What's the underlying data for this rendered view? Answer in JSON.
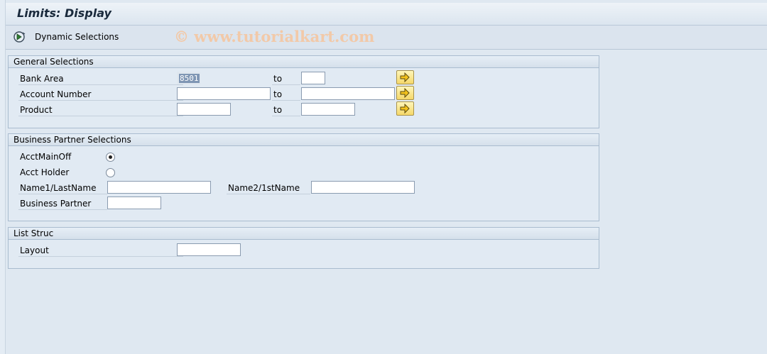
{
  "title": "Limits: Display",
  "toolbar": {
    "dynamic_selections_label": "Dynamic Selections",
    "dynamic_selections_icon": "dynamic-selections-icon"
  },
  "watermark": "© www.tutorialkart.com",
  "general": {
    "header": "General Selections",
    "to_label": "to",
    "rows": [
      {
        "label": "Bank Area",
        "low_value": "8501",
        "high_value": ""
      },
      {
        "label": "Account Number",
        "low_value": "",
        "high_value": ""
      },
      {
        "label": "Product",
        "low_value": "",
        "high_value": ""
      }
    ]
  },
  "partner": {
    "header": "Business Partner Selections",
    "acct_main_off": "AcctMainOff",
    "acct_main_off_selected": true,
    "acct_holder": "Acct Holder",
    "acct_holder_selected": false,
    "name1_label": "Name1/LastName",
    "name1_value": "",
    "name2_label": "Name2/1stName",
    "name2_value": "",
    "bp_label": "Business Partner",
    "bp_value": ""
  },
  "list": {
    "header": "List Struc",
    "layout_label": "Layout",
    "layout_value": ""
  },
  "colors": {
    "background": "#dfe8f1",
    "multi_select_button": "#f5d86a",
    "watermark": "#f2c9a8"
  }
}
